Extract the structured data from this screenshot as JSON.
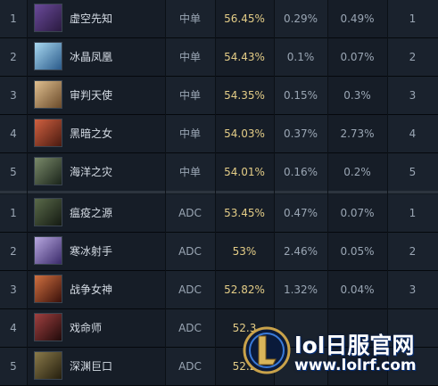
{
  "rows": [
    {
      "rank": "1",
      "name": "虚空先知",
      "lane": "中单",
      "win_rate": "56.45%",
      "pick_rate": "0.29%",
      "ban_rate": "0.49%",
      "position": "1",
      "avatar_color": "#6a4a9a"
    },
    {
      "rank": "2",
      "name": "冰晶凤凰",
      "lane": "中单",
      "win_rate": "54.43%",
      "pick_rate": "0.1%",
      "ban_rate": "0.07%",
      "position": "2",
      "avatar_color": "#6aa8d8"
    },
    {
      "rank": "3",
      "name": "审判天使",
      "lane": "中单",
      "win_rate": "54.35%",
      "pick_rate": "0.15%",
      "ban_rate": "0.3%",
      "position": "3",
      "avatar_color": "#c8a070"
    },
    {
      "rank": "4",
      "name": "黑暗之女",
      "lane": "中单",
      "win_rate": "54.03%",
      "pick_rate": "0.37%",
      "ban_rate": "2.73%",
      "position": "4",
      "avatar_color": "#b04030"
    },
    {
      "rank": "5",
      "name": "海洋之灾",
      "lane": "中单",
      "win_rate": "54.01%",
      "pick_rate": "0.16%",
      "ban_rate": "0.2%",
      "position": "5",
      "avatar_color": "#4a5a4a"
    },
    {
      "rank": "1",
      "name": "瘟疫之源",
      "lane": "ADC",
      "win_rate": "53.45%",
      "pick_rate": "0.47%",
      "ban_rate": "0.07%",
      "position": "1",
      "avatar_color": "#3a4a3a"
    },
    {
      "rank": "2",
      "name": "寒冰射手",
      "lane": "ADC",
      "win_rate": "53%",
      "pick_rate": "2.46%",
      "ban_rate": "0.05%",
      "position": "2",
      "avatar_color": "#7a6aa8"
    },
    {
      "rank": "3",
      "name": "战争女神",
      "lane": "ADC",
      "win_rate": "52.82%",
      "pick_rate": "1.32%",
      "ban_rate": "0.04%",
      "position": "3",
      "avatar_color": "#a03a2a"
    },
    {
      "rank": "4",
      "name": "戏命师",
      "lane": "ADC",
      "win_rate": "52.3",
      "pick_rate": "",
      "ban_rate": "",
      "position": "",
      "avatar_color": "#8a3a3a"
    },
    {
      "rank": "5",
      "name": "深渊巨口",
      "lane": "ADC",
      "win_rate": "52.2",
      "pick_rate": "",
      "ban_rate": "",
      "position": "",
      "avatar_color": "#5a5a3a"
    }
  ],
  "watermark": {
    "title": "lol日服官网",
    "url": "www.lolrf.com",
    "logo_letter": "L"
  },
  "colors": {
    "win_rate": "#e4cd87",
    "text": "#9aa6b4",
    "name": "#d6dde6"
  }
}
